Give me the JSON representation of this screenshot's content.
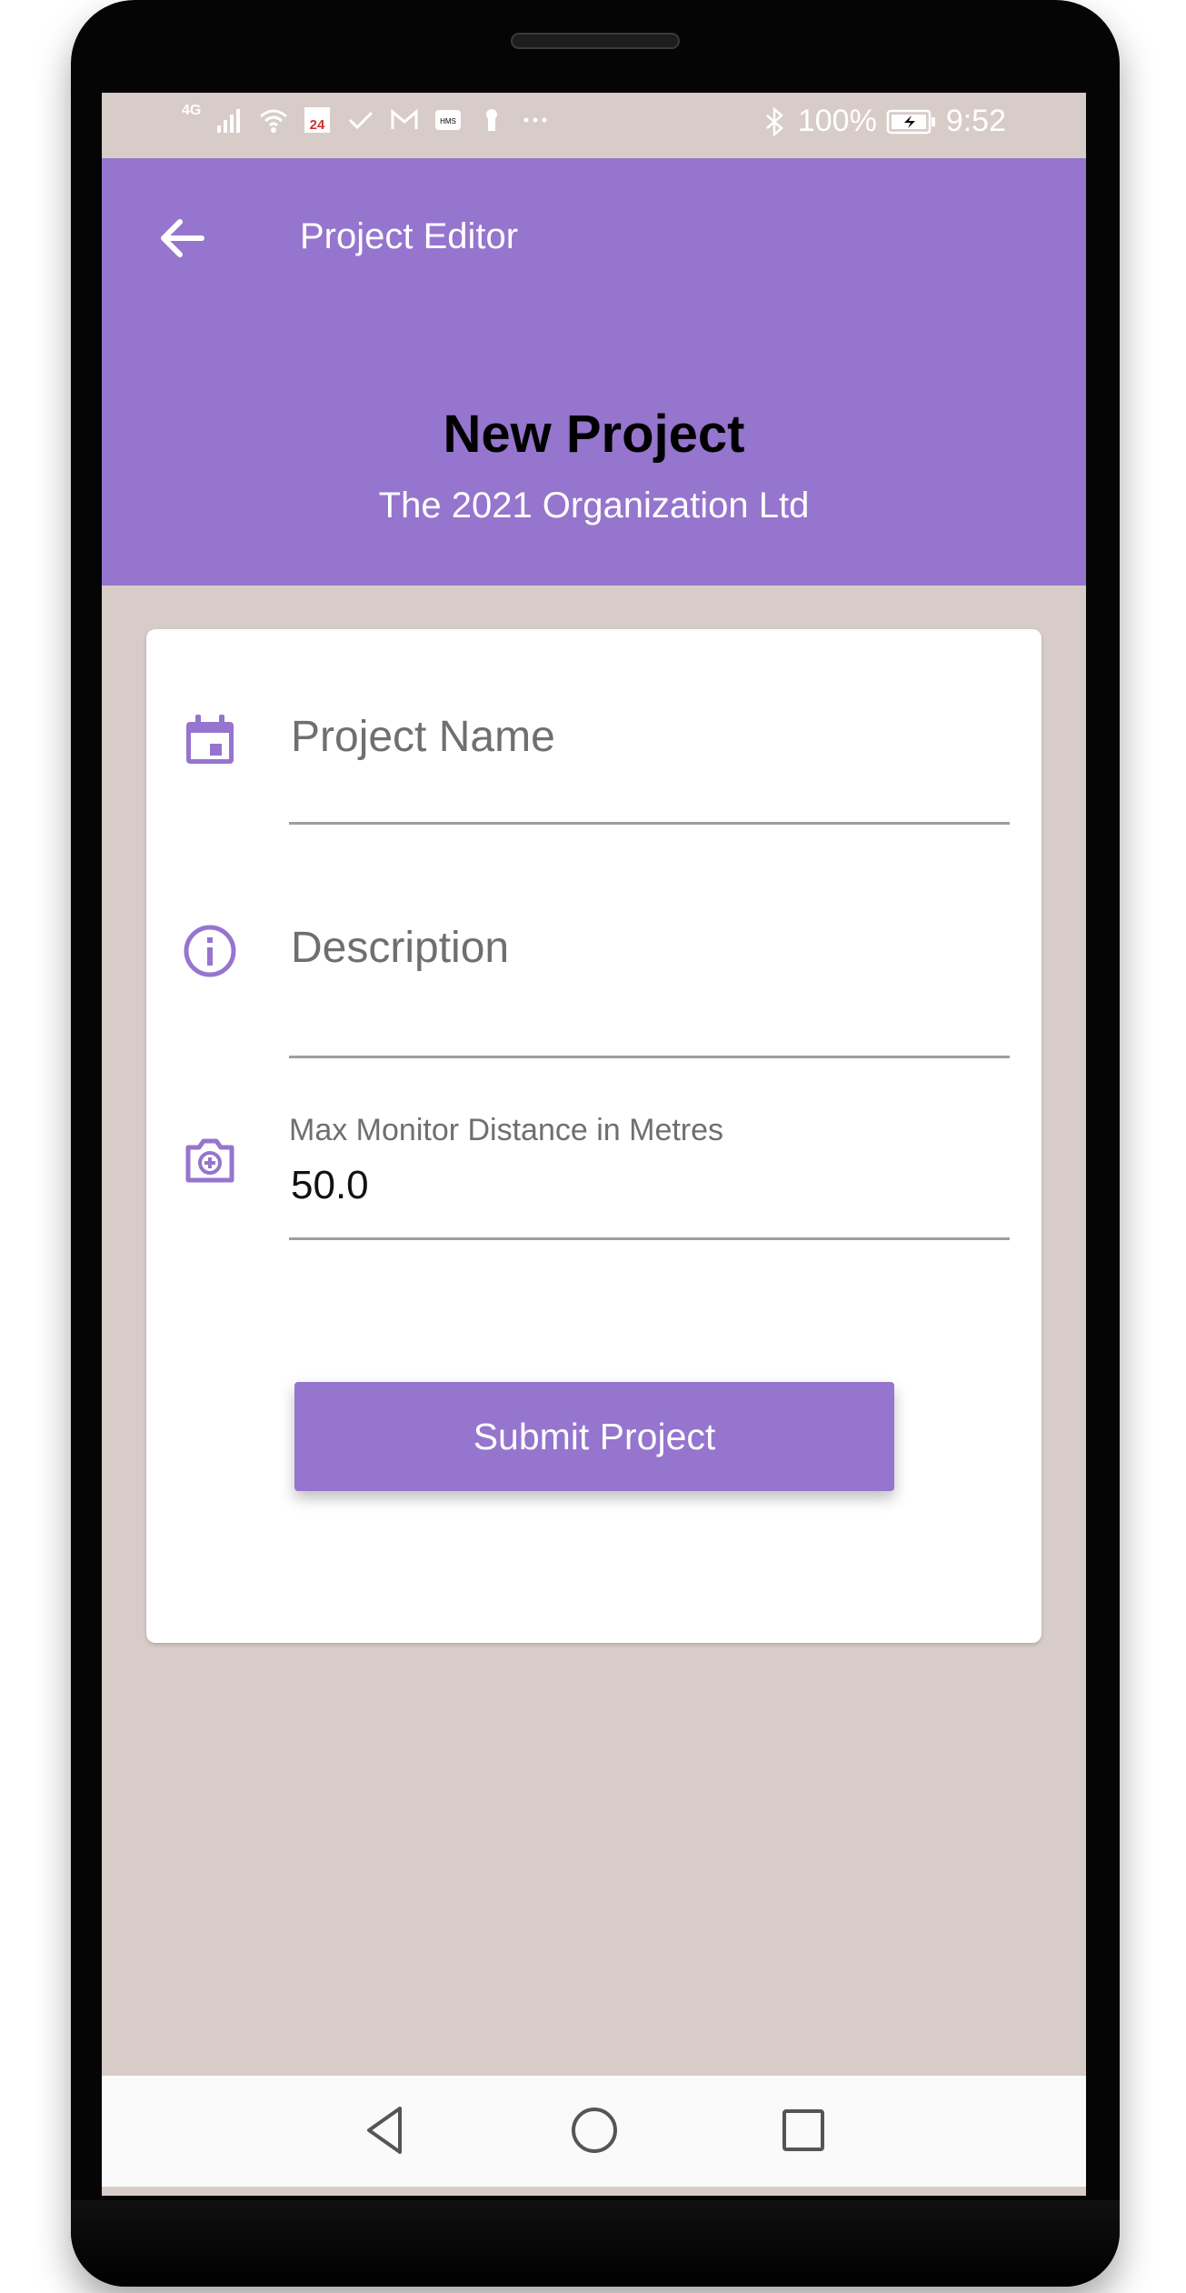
{
  "status_bar": {
    "network": "4G",
    "battery": "100%",
    "time": "9:52",
    "icons_left": [
      "signal-icon",
      "wifi-icon",
      "news-icon",
      "check-icon",
      "gmail-icon",
      "sms-icon",
      "keyhole-icon",
      "more-icon"
    ],
    "icons_right": [
      "bluetooth-icon",
      "battery-icon"
    ]
  },
  "appbar": {
    "title": "Project Editor",
    "back_icon": "arrow-left-icon"
  },
  "header": {
    "title": "New Project",
    "subtitle": "The 2021 Organization Ltd"
  },
  "form": {
    "project_name": {
      "placeholder": "Project Name",
      "value": "",
      "icon": "calendar-icon"
    },
    "description": {
      "placeholder": "Description",
      "value": "",
      "icon": "info-icon"
    },
    "max_distance": {
      "label": "Max Monitor Distance in Metres",
      "value": "50.0",
      "icon": "camera-add-icon"
    },
    "submit_label": "Submit Project"
  },
  "nav": {
    "back": "triangle-back-icon",
    "home": "circle-home-icon",
    "recents": "square-recents-icon"
  },
  "colors": {
    "primary": "#9575cd",
    "background": "#d7ccc8",
    "card": "#ffffff",
    "hero_title": "#000000"
  }
}
